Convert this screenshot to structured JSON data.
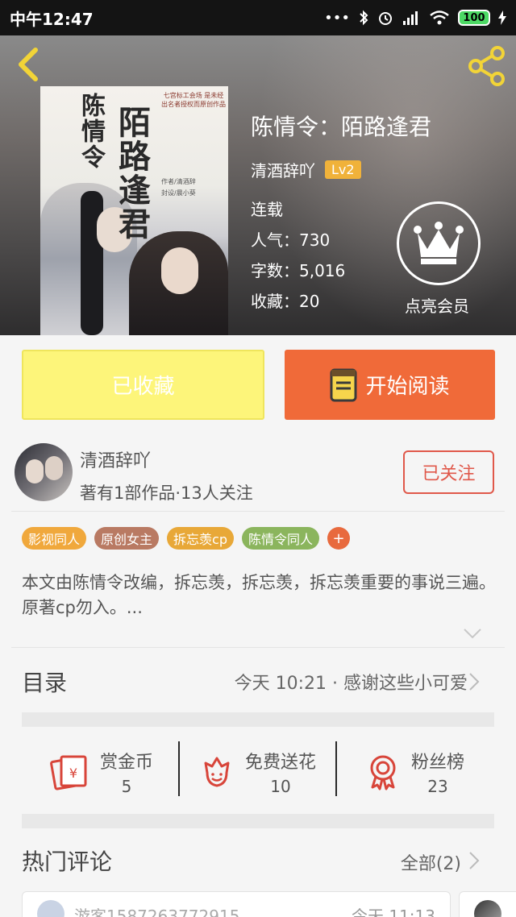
{
  "status_bar": {
    "time": "中午12:47",
    "battery": "100",
    "icons": [
      "dots-icon",
      "bluetooth-icon",
      "alarm-icon",
      "signal-icon",
      "wifi-icon",
      "battery-icon",
      "charging-icon"
    ]
  },
  "book": {
    "title": "陈情令：陌路逢君",
    "author": "清酒辞吖",
    "level": "Lv2",
    "status": "连载",
    "popularity": "人气：730",
    "word_count": "字数：5,016",
    "favorites": "收藏：20",
    "vip_label": "点亮会员",
    "cover": {
      "title_line1": "陈情令",
      "title_line2": "陌路逢君",
      "note": "七宫标工会场 是未经 出名者授权而原创作品",
      "credit1": "作者/清酒辞",
      "credit2": "封设/晨小葵"
    }
  },
  "actions": {
    "collected_label": "已收藏",
    "read_label": "开始阅读"
  },
  "author_card": {
    "name": "清酒辞吖",
    "info": "著有1部作品·13人关注",
    "follow_label": "已关注"
  },
  "tags": [
    {
      "label": "影视同人",
      "color": "#f0a83c"
    },
    {
      "label": "原创女主",
      "color": "#b97a63"
    },
    {
      "label": "拆忘羡cp",
      "color": "#e8a838"
    },
    {
      "label": "陈情令同人",
      "color": "#8bb55d"
    }
  ],
  "tag_add": "+",
  "description": "本文由陈情令改编，拆忘羡，拆忘羡，拆忘羡重要的事说三遍。原著cp勿入。...",
  "toc": {
    "label": "目录",
    "update": "今天 10:21 · 感谢这些小可爱"
  },
  "rewards": [
    {
      "label": "赏金币",
      "value": "5",
      "icon": "red-envelope-icon"
    },
    {
      "label": "免费送花",
      "value": "10",
      "icon": "flower-icon"
    },
    {
      "label": "粉丝榜",
      "value": "23",
      "icon": "medal-icon"
    }
  ],
  "hot_comments": {
    "label": "热门评论",
    "all_label": "全部(2)",
    "first_user": "游客1587263772915",
    "first_time": "今天 11:13"
  },
  "colors": {
    "accent_orange": "#f06a39",
    "collected_yellow": "#fdf57a",
    "follow_red": "#e0584a",
    "level_badge": "#f0b23a",
    "icon_red": "#d8453a"
  }
}
